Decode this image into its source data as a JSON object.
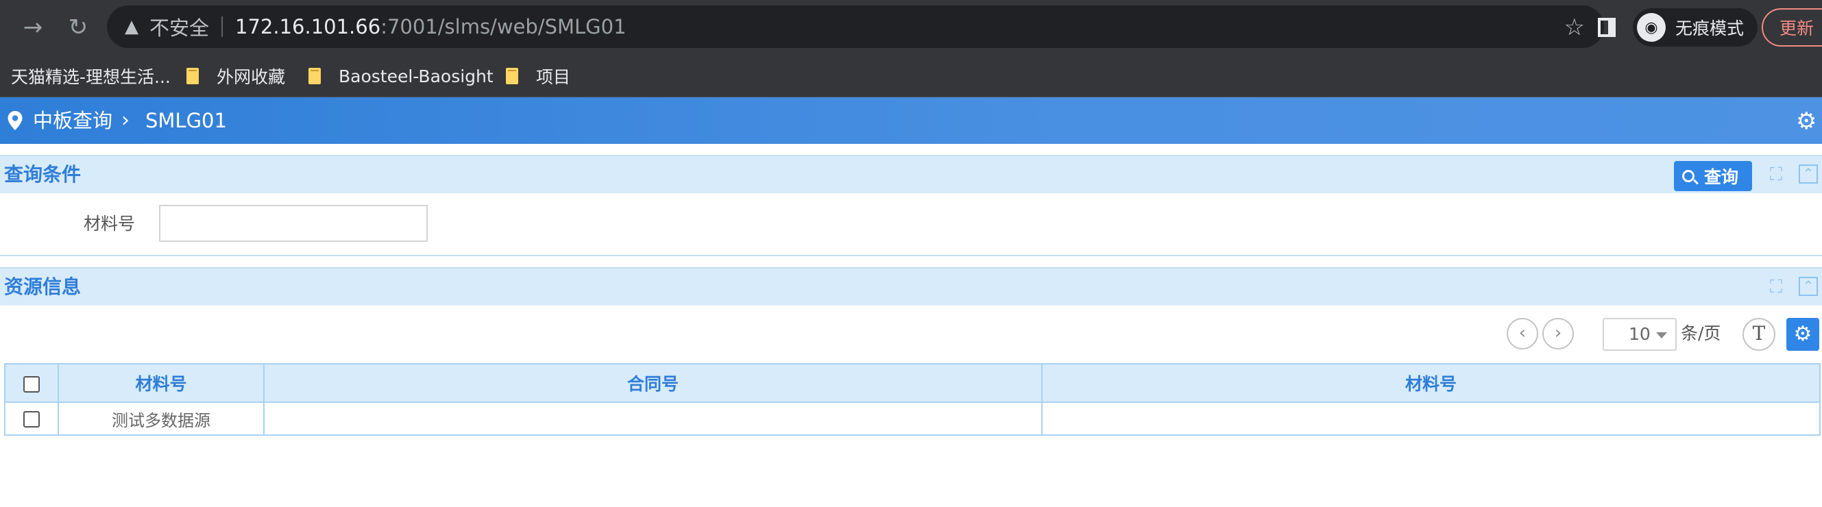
{
  "browser": {
    "security_label": "不安全",
    "url_host": "172.16.101.66",
    "url_path": ":7001/slms/web/SMLG01",
    "incognito_label": "无痕模式",
    "update_label": "更新",
    "bookmarks": [
      {
        "label": "天猫精选-理想生活..."
      },
      {
        "label": "外网收藏"
      },
      {
        "label": "Baosteel-Baosight"
      },
      {
        "label": "项目"
      }
    ]
  },
  "header": {
    "breadcrumb_root": "中板查询",
    "breadcrumb_current": "SMLG01"
  },
  "query_panel": {
    "title": "查询条件",
    "query_button_label": "查询",
    "field_label": "材料号",
    "field_value": ""
  },
  "resource_panel": {
    "title": "资源信息",
    "page_size": "10",
    "per_page_label": "条/页",
    "text_button_glyph": "T",
    "columns": [
      "材料号",
      "合同号",
      "材料号"
    ],
    "rows": [
      {
        "cells": [
          "测试多数据源",
          "",
          ""
        ]
      }
    ]
  },
  "colors": {
    "accent": "#2f7ed8",
    "panel_header_bg": "#d8ebfa",
    "chrome_bg": "#35363a"
  }
}
